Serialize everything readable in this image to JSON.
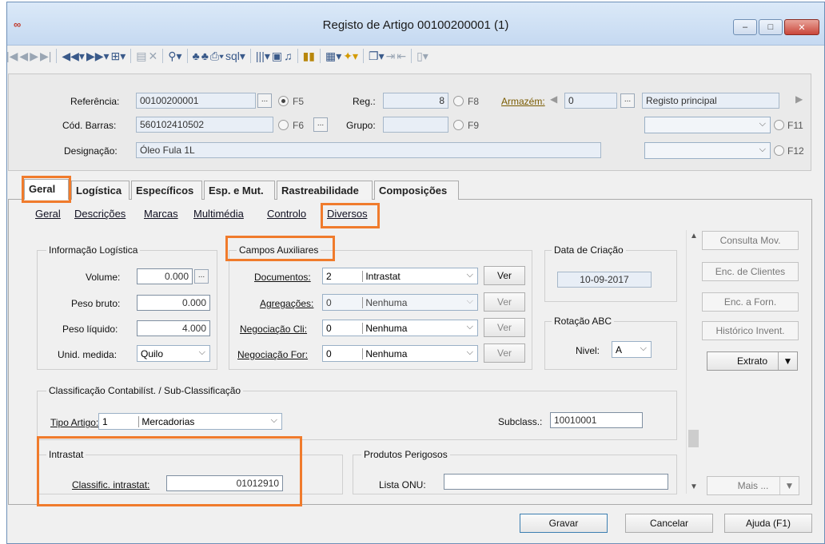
{
  "window": {
    "title": "Registo de Artigo 00100200001 (1)",
    "app_icon": "∞",
    "minimize": "‒",
    "maximize": "□",
    "close": "✕"
  },
  "header": {
    "referencia_label": "Referência:",
    "referencia_value": "00100200001",
    "f5": "F5",
    "reg_label": "Reg.:",
    "reg_value": "8",
    "f8": "F8",
    "armazem_label": "Armazém:",
    "armazem_value": "0",
    "armazem_desc": "Registo principal",
    "barras_label": "Cód. Barras:",
    "barras_value": "560102410502",
    "f6": "F6",
    "grupo_label": "Grupo:",
    "grupo_value": "",
    "f9": "F9",
    "f11": "F11",
    "designacao_label": "Designação:",
    "designacao_value": "Óleo Fula 1L",
    "f12": "F12"
  },
  "tabs": [
    "Geral",
    "Logística",
    "Específicos",
    "Esp. e Mut.",
    "Rastreabilidade",
    "Composições"
  ],
  "subtabs": [
    "Geral",
    "Descrições",
    "Marcas",
    "Multimédia",
    "Controlo",
    "Diversos"
  ],
  "info_log": {
    "title": "Informação Logística",
    "volume_label": "Volume:",
    "volume": "0.000",
    "peso_bruto_label": "Peso bruto:",
    "peso_bruto": "0.000",
    "peso_liquido_label": "Peso líquido:",
    "peso_liquido": "4.000",
    "unid_label": "Unid. medida:",
    "unid": "Quilo"
  },
  "campos": {
    "title": "Campos Auxiliares",
    "ver": "Ver",
    "rows": [
      {
        "label": "Documentos:",
        "num": "2",
        "value": "Intrastat"
      },
      {
        "label": "Agregações:",
        "num": "0",
        "value": "Nenhuma"
      },
      {
        "label": "Negociação Cli:",
        "num": "0",
        "value": "Nenhuma"
      },
      {
        "label": "Negociação For:",
        "num": "0",
        "value": "Nenhuma"
      }
    ]
  },
  "data_criacao": {
    "title": "Data de Criação",
    "value": "10-09-2017"
  },
  "rotacao": {
    "title": "Rotação ABC",
    "nivel_label": "Nivel:",
    "nivel": "A"
  },
  "classif": {
    "title": "Classificação Contabilíst. / Sub-Classificação",
    "tipo_label": "Tipo Artigo:",
    "tipo_num": "1",
    "tipo_value": "Mercadorias",
    "subclass_label": "Subclass.:",
    "subclass_value": "10010001"
  },
  "intrastat": {
    "title": "Intrastat",
    "classif_label": "Classific. intrastat:",
    "classif_value": "01012910"
  },
  "perigosos": {
    "title": "Produtos Perigosos",
    "onu_label": "Lista ONU:",
    "onu_value": ""
  },
  "side_buttons": {
    "consulta": "Consulta Mov.",
    "enc_clientes": "Enc. de Clientes",
    "enc_forn": "Enc. a Forn.",
    "historico": "Histórico Invent.",
    "extrato": "Extrato",
    "mais": "Mais ..."
  },
  "footer": {
    "gravar": "Gravar",
    "cancelar": "Cancelar",
    "ajuda": "Ajuda (F1)"
  }
}
